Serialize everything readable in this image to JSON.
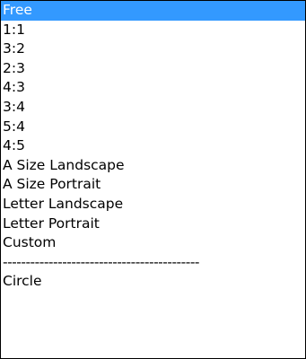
{
  "dropdown": {
    "selected_value": "Free",
    "colors": {
      "selected_background": "#3399ff",
      "selected_text": "#ffffff",
      "text": "#000000",
      "background": "#ffffff"
    },
    "items": [
      {
        "label": "Free"
      },
      {
        "label": "1:1"
      },
      {
        "label": "3:2"
      },
      {
        "label": "2:3"
      },
      {
        "label": "4:3"
      },
      {
        "label": "3:4"
      },
      {
        "label": "5:4"
      },
      {
        "label": "4:5"
      },
      {
        "label": "A Size Landscape"
      },
      {
        "label": "A Size Portrait"
      },
      {
        "label": "Letter Landscape"
      },
      {
        "label": "Letter Portrait"
      },
      {
        "label": "Custom"
      },
      {
        "label": "-------------------------------------------"
      },
      {
        "label": "Circle"
      }
    ]
  }
}
